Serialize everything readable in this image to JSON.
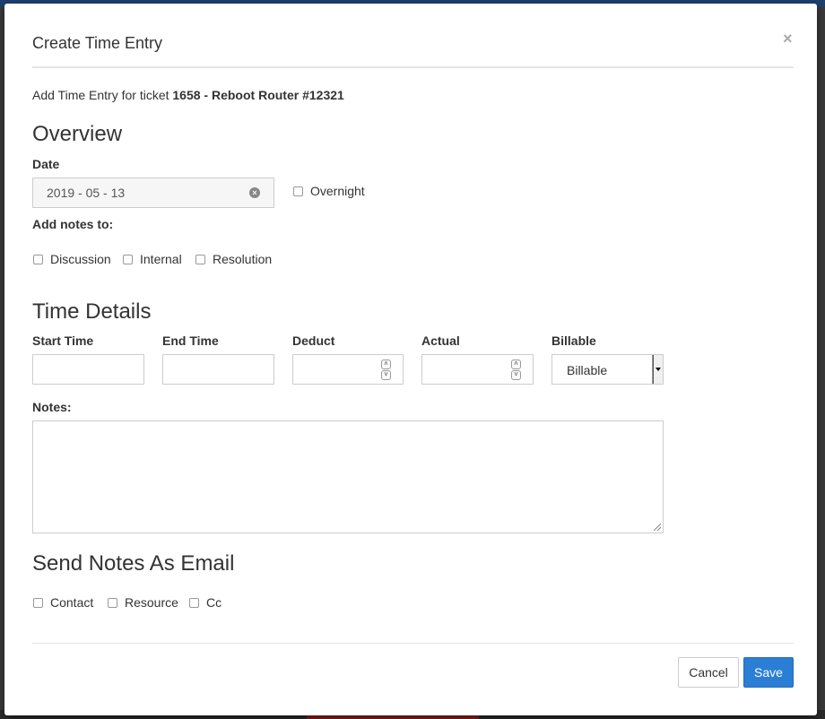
{
  "modal": {
    "title": "Create Time Entry",
    "close": "×",
    "intro_prefix": "Add Time Entry for ticket ",
    "ticket": "1658 - Reboot Router #12321"
  },
  "overview": {
    "heading": "Overview",
    "date_label": "Date",
    "date_value": "2019 - 05 - 13",
    "overnight_label": "Overnight",
    "add_notes_label": "Add notes to:",
    "notes_targets": [
      "Discussion",
      "Internal",
      "Resolution"
    ]
  },
  "time_details": {
    "heading": "Time Details",
    "start_label": "Start Time",
    "end_label": "End Time",
    "deduct_label": "Deduct",
    "actual_label": "Actual",
    "billable_label": "Billable",
    "billable_value": "Billable",
    "notes_label": "Notes:"
  },
  "email": {
    "heading": "Send Notes As Email",
    "recipients": [
      "Contact",
      "Resource",
      "Cc"
    ]
  },
  "footer": {
    "cancel": "Cancel",
    "save": "Save"
  },
  "colors": {
    "primary": "#2a7ed3",
    "border": "#cccccc"
  }
}
